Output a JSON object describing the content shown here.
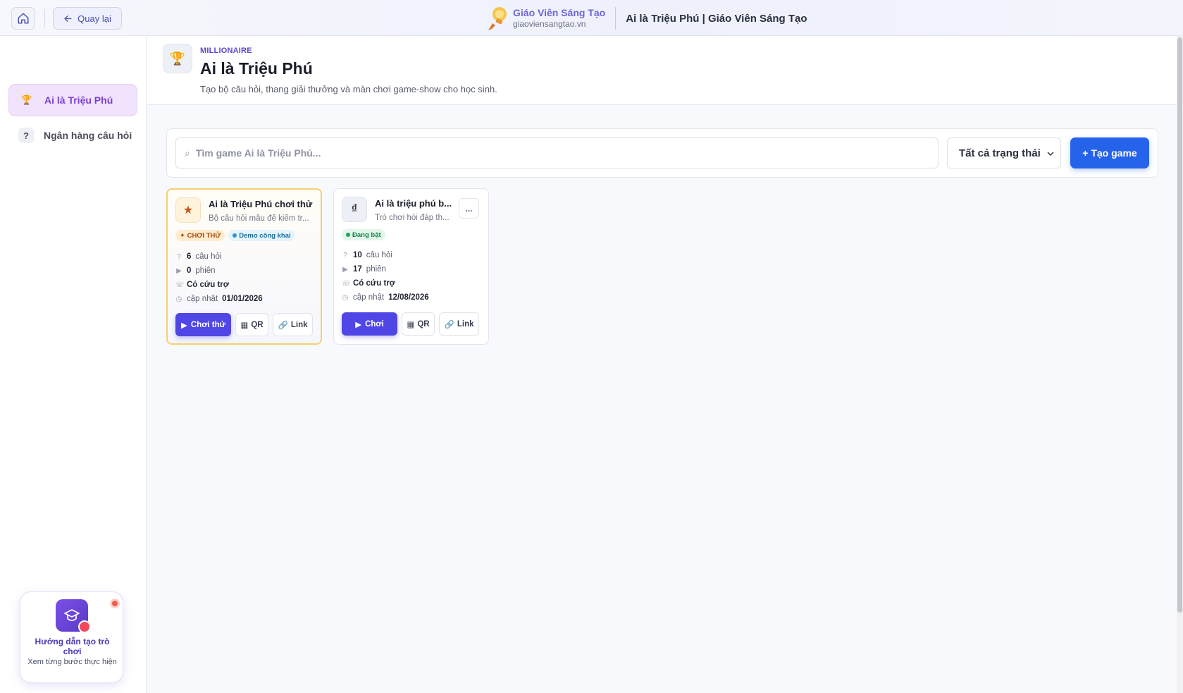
{
  "topbar": {
    "back_label": "Quay lại",
    "brand_name": "Giáo Viên Sáng Tạo",
    "brand_url": "giaoviensangtao.vn",
    "page_title": "Ai là Triệu Phú | Giáo Viên Sáng Tạo"
  },
  "sidebar": {
    "items": [
      {
        "label": "Ai là Triệu Phú",
        "icon": "trophy-icon",
        "active": true
      },
      {
        "label": "Ngân hàng câu hỏi",
        "icon": "question-icon",
        "active": false
      }
    ],
    "guide": {
      "title": "Hướng dẫn tạo trò chơi",
      "subtitle": "Xem từng bước thực hiện"
    }
  },
  "header": {
    "eyebrow": "MILLIONAIRE",
    "title": "Ai là Triệu Phú",
    "description": "Tạo bộ câu hỏi, thang giải thưởng và màn chơi game-show cho học sinh."
  },
  "toolbar": {
    "search_placeholder": "Tìm game Ai là Triệu Phú...",
    "status_filter": "Tất cả trạng thái",
    "create_label": "+ Tạo game"
  },
  "cards": [
    {
      "icon": "star-icon",
      "icon_glyph": "★",
      "title": "Ai là Triệu Phú chơi thử",
      "description": "Bộ câu hỏi mẫu để kiểm tr...",
      "badges": [
        "✦ CHƠI THỬ",
        "Demo công khai"
      ],
      "questions_count": "6",
      "questions_label": "câu hỏi",
      "sessions_count": "0",
      "sessions_label": "phiên",
      "lifeline": "Có cứu trợ",
      "updated_label": "cập nhật",
      "updated_date": "01/01/2026",
      "play_label": "Chơi thử",
      "qr_label": "QR",
      "link_label": "Link"
    },
    {
      "icon": "dong-icon",
      "icon_glyph": "₫",
      "title": "Ai là triệu phú b...",
      "description": "Trò chơi hỏi đáp th...",
      "more_label": "...",
      "badges": [
        "Đang bật"
      ],
      "questions_count": "10",
      "questions_label": "câu hỏi",
      "sessions_count": "17",
      "sessions_label": "phiên",
      "lifeline": "Có cứu trợ",
      "updated_label": "cập nhật",
      "updated_date": "12/08/2026",
      "play_label": "Chơi",
      "qr_label": "QR",
      "link_label": "Link"
    }
  ],
  "colors": {
    "primary": "#4f46e5",
    "create_button": "#2563eb",
    "active_nav_bg": "#f0e3fb",
    "featured_border": "#f5cf73"
  }
}
